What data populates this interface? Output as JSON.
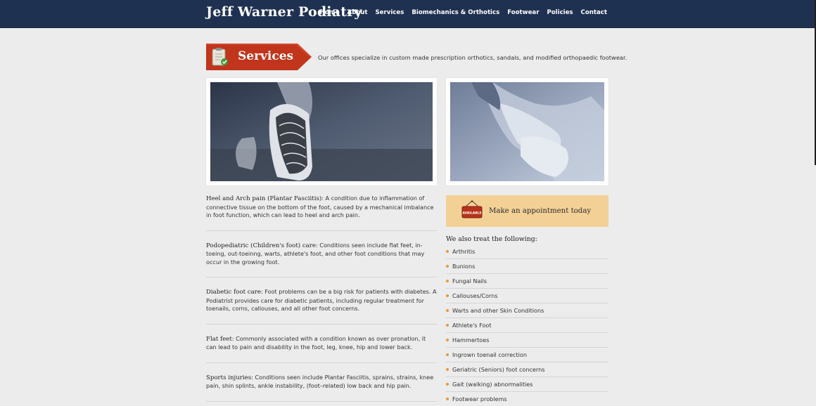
{
  "header": {
    "site_title": "Jeff Warner Podiatry",
    "nav": [
      "Home",
      "About",
      "Services",
      "Biomechanics & Orthotics",
      "Footwear",
      "Policies",
      "Contact"
    ]
  },
  "services": {
    "title": "Services",
    "intro": "Our offices specialize in custom made prescription orthotics, sandals, and modified orthopaedic footwear."
  },
  "conditions": [
    {
      "title": "Heel and Arch pain (Plantar Fasciitis)",
      "text": ": A condition due to inflammation of connective tissue on the bottom of the foot, caused by a mechanical imbalance in foot function, which can lead to heel and arch pain."
    },
    {
      "title": "Podopediatric (Children's foot) care",
      "text": ": Conditions seen include flat feet, in-toeing, out-toeinng, warts, athlete's foot, and other foot conditions that may occur in the growing foot."
    },
    {
      "title": "Diabetic foot care",
      "text": ": Foot problems can be a big risk for patients with diabetes. A Podiatrist provides care for diabetic patients, including regular treatment for toenails, corns, callouses, and all other foot concerns."
    },
    {
      "title": "Flat feet",
      "text": ": Commonly associated with a condition known as over pronation, it can lead to pain and disability in the foot, leg, knee, hip and lower back."
    },
    {
      "title": "Sports injuries",
      "text": ": Conditions seen include Plantar Fasciitis, sprains, strains, knee pain, shin splints, ankle instability, (foot–related) low back and hip pain."
    }
  ],
  "appointment": {
    "label": "Make an appointment today",
    "sign_text": "AVAILABLE"
  },
  "treat": {
    "heading": "We also treat the following:",
    "items": [
      "Arthritis",
      "Bunions",
      "Fungal Nails",
      "Callouses/Corns",
      "Warts and other Skin Conditions",
      "Athlete's Foot",
      "Hammertoes",
      "Ingrown toenail correction",
      "Geriatric (Seniors) foot concerns",
      "Gait (walking) abnormalities",
      "Footwear problems"
    ]
  },
  "colors": {
    "header_bg": "#1f3150",
    "banner_red": "#c0351c",
    "appointment_bg": "#f3d196",
    "bullet": "#e39b3a"
  }
}
